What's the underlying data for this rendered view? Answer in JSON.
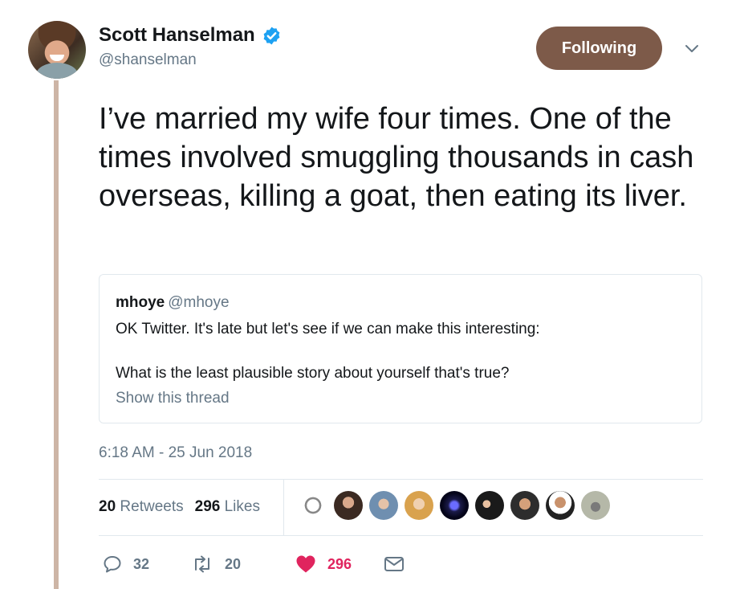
{
  "author": {
    "display_name": "Scott Hanselman",
    "handle": "@shanselman",
    "verified": true
  },
  "follow_button_label": "Following",
  "tweet": {
    "text": "I’ve married my wife four times. One of the times involved smuggling thousands in cash overseas, killing a goat, then eating its liver."
  },
  "quote": {
    "name": "mhoye",
    "handle": "@mhoye",
    "line1": "OK Twitter. It's late but let's see if we can make this interesting:",
    "line2": "What is the least plausible story about yourself that's true?",
    "show_thread": "Show this thread"
  },
  "timestamp": "6:18 AM - 25 Jun 2018",
  "stats": {
    "retweets_count": "20",
    "retweets_label": "Retweets",
    "likes_count": "296",
    "likes_label": "Likes"
  },
  "actions": {
    "reply_count": "32",
    "retweet_count": "20",
    "like_count": "296"
  },
  "colors": {
    "follow_button": "#7d5a49",
    "thread_line": "#cdb5a6",
    "verified": "#1da1f2",
    "like": "#e0245e",
    "secondary_text": "#657786"
  },
  "icons": [
    "verified-icon",
    "caret-down-icon",
    "reply-icon",
    "retweet-icon",
    "heart-icon",
    "message-icon"
  ]
}
